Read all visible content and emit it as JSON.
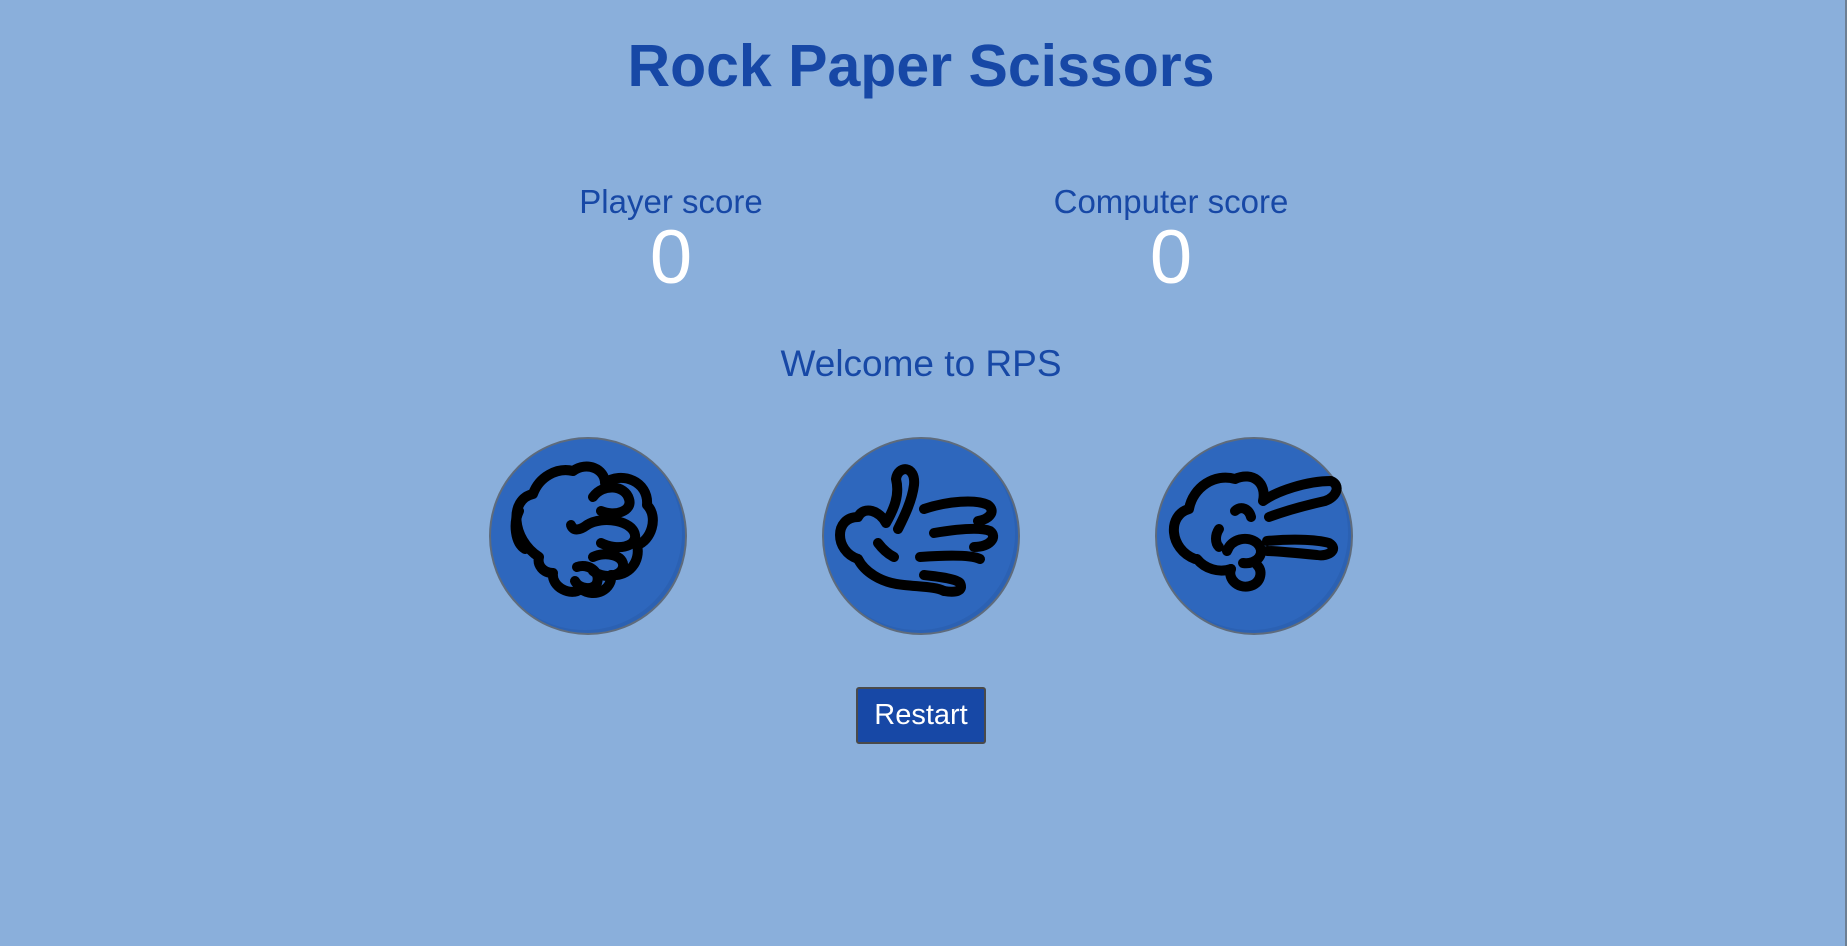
{
  "header": {
    "title": "Rock Paper Scissors"
  },
  "scores": {
    "player_label": "Player score",
    "player_value": "0",
    "computer_label": "Computer score",
    "computer_value": "0"
  },
  "message": "Welcome to RPS",
  "choices": [
    {
      "id": "rock",
      "icon": "rock-fist-icon"
    },
    {
      "id": "paper",
      "icon": "paper-hand-icon"
    },
    {
      "id": "scissors",
      "icon": "scissors-hand-icon"
    }
  ],
  "controls": {
    "restart_label": "Restart"
  },
  "colors": {
    "background": "#8aafdb",
    "accent": "#1748a6",
    "choice_fill": "#2e67bd",
    "score_value": "#ffffff"
  }
}
